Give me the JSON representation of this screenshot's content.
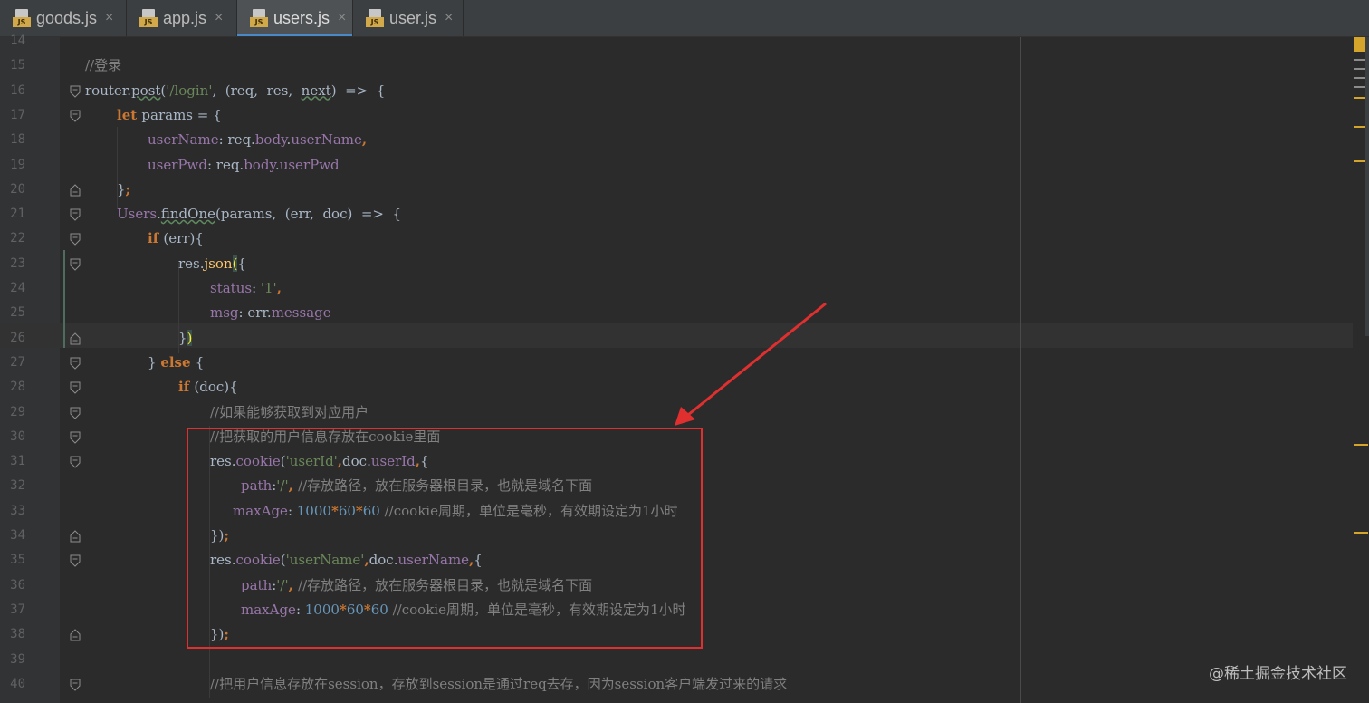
{
  "tabs": [
    {
      "label": "goods.js",
      "close": "×",
      "icon": "JS"
    },
    {
      "label": "app.js",
      "close": "×",
      "icon": "JS"
    },
    {
      "label": "users.js",
      "close": "×",
      "icon": "JS",
      "active": true
    },
    {
      "label": "user.js",
      "close": "×",
      "icon": "JS"
    }
  ],
  "line_numbers": [
    "14",
    "15",
    "16",
    "17",
    "18",
    "19",
    "20",
    "21",
    "22",
    "23",
    "24",
    "25",
    "26",
    "27",
    "28",
    "29",
    "30",
    "31",
    "32",
    "33",
    "34",
    "35",
    "36",
    "37",
    "38",
    "39",
    "40"
  ],
  "code": [
    [],
    [
      [
        "cm",
        "//登录"
      ]
    ],
    [
      [
        "pl",
        "router."
      ],
      [
        "fnw",
        "post"
      ],
      [
        "pl",
        "("
      ],
      [
        "str",
        "'/login'"
      ],
      [
        "pl",
        ",  (req,  res,  "
      ],
      [
        "plw",
        "next"
      ],
      [
        "pl",
        ")  =>  {"
      ]
    ],
    [
      [
        "kw",
        "let "
      ],
      [
        "pl",
        "params = {"
      ]
    ],
    [
      [
        "prop",
        "userName"
      ],
      [
        "pl",
        ": req."
      ],
      [
        "prop",
        "body"
      ],
      [
        "pl",
        "."
      ],
      [
        "prop",
        "userName"
      ],
      [
        "kw",
        ","
      ]
    ],
    [
      [
        "prop",
        "userPwd"
      ],
      [
        "pl",
        ": req."
      ],
      [
        "prop",
        "body"
      ],
      [
        "pl",
        "."
      ],
      [
        "prop",
        "userPwd"
      ]
    ],
    [
      [
        "pl",
        "}"
      ],
      [
        "kw",
        ";"
      ]
    ],
    [
      [
        "prop",
        "Users"
      ],
      [
        "pl",
        "."
      ],
      [
        "fnw",
        "findOne"
      ],
      [
        "pl",
        "(params,  (err,  doc)  =>  {"
      ]
    ],
    [
      [
        "kw",
        "if "
      ],
      [
        "pl",
        "(err){"
      ]
    ],
    [
      [
        "pl",
        "res."
      ],
      [
        "fn",
        "json"
      ],
      [
        "bh",
        "("
      ],
      [
        "pl",
        "{"
      ]
    ],
    [
      [
        "prop",
        "status"
      ],
      [
        "pl",
        ": "
      ],
      [
        "str",
        "'1'"
      ],
      [
        "kw",
        ","
      ]
    ],
    [
      [
        "prop",
        "msg"
      ],
      [
        "pl",
        ": err."
      ],
      [
        "prop",
        "message"
      ]
    ],
    [
      [
        "pl",
        "}"
      ],
      [
        "bh",
        ")"
      ]
    ],
    [
      [
        "pl",
        "} "
      ],
      [
        "kw",
        "else "
      ],
      [
        "pl",
        "{"
      ]
    ],
    [
      [
        "kw",
        "if "
      ],
      [
        "pl",
        "(doc){"
      ]
    ],
    [
      [
        "cm",
        "//如果能够获取到对应用户"
      ]
    ],
    [
      [
        "cm",
        "//把获取的用户信息存放在cookie里面"
      ]
    ],
    [
      [
        "pl",
        "res."
      ],
      [
        "prop",
        "cookie"
      ],
      [
        "pl",
        "("
      ],
      [
        "str",
        "'userId'"
      ],
      [
        "kw",
        ","
      ],
      [
        "pl",
        "doc."
      ],
      [
        "prop",
        "userId"
      ],
      [
        "kw",
        ","
      ],
      [
        "pl",
        "{"
      ]
    ],
    [
      [
        "prop",
        "path"
      ],
      [
        "pl",
        ":"
      ],
      [
        "str",
        "'/'"
      ],
      [
        "kw",
        ", "
      ],
      [
        "cm",
        "//存放路径，放在服务器根目录，也就是域名下面"
      ]
    ],
    [
      [
        "prop",
        "maxAge"
      ],
      [
        "pl",
        ": "
      ],
      [
        "num",
        "1000"
      ],
      [
        "kw",
        "*"
      ],
      [
        "num",
        "60"
      ],
      [
        "kw",
        "*"
      ],
      [
        "num",
        "60"
      ],
      [
        "cm",
        " //cookie周期，单位是毫秒，有效期设定为1小时"
      ]
    ],
    [
      [
        "pl",
        "})"
      ],
      [
        "kw",
        ";"
      ]
    ],
    [
      [
        "pl",
        "res."
      ],
      [
        "prop",
        "cookie"
      ],
      [
        "pl",
        "("
      ],
      [
        "str",
        "'userName'"
      ],
      [
        "kw",
        ","
      ],
      [
        "pl",
        "doc."
      ],
      [
        "prop",
        "userName"
      ],
      [
        "kw",
        ","
      ],
      [
        "pl",
        "{"
      ]
    ],
    [
      [
        "prop",
        "path"
      ],
      [
        "pl",
        ":"
      ],
      [
        "str",
        "'/'"
      ],
      [
        "kw",
        ", "
      ],
      [
        "cm",
        "//存放路径，放在服务器根目录，也就是域名下面"
      ]
    ],
    [
      [
        "prop",
        "maxAge"
      ],
      [
        "pl",
        ": "
      ],
      [
        "num",
        "1000"
      ],
      [
        "kw",
        "*"
      ],
      [
        "num",
        "60"
      ],
      [
        "kw",
        "*"
      ],
      [
        "num",
        "60"
      ],
      [
        "cm",
        " //cookie周期，单位是毫秒，有效期设定为1小时"
      ]
    ],
    [
      [
        "pl",
        "})"
      ],
      [
        "kw",
        ";"
      ]
    ],
    [],
    [
      [
        "cm",
        "//把用户信息存放在session，存放到session是通过req去存，因为session客户端发过来的请求"
      ]
    ]
  ],
  "watermark": "@稀土掘金技术社区",
  "colors": {
    "highlight_box": "#e02f2f",
    "arrow": "#e02f2f",
    "accent": "#4a88c7"
  }
}
